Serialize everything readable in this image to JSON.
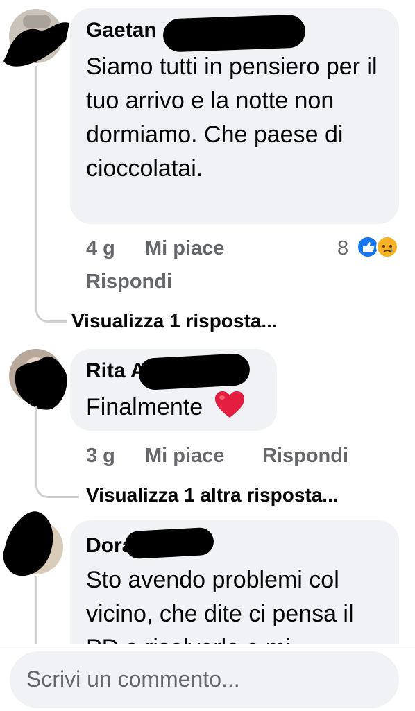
{
  "comments": [
    {
      "author": "Gaetan",
      "text": "Siamo tutti in pensiero per il tuo arrivo e la notte non dormiamo. Che paese di cioccolatai.",
      "time": "4 g",
      "like_label": "Mi piace",
      "reply_label": "Rispondi",
      "reaction_count": "8",
      "reactions": [
        "like-icon",
        "sad-icon"
      ],
      "view_replies": "Visualizza 1 risposta..."
    },
    {
      "author": "Rita A",
      "text": "Finalmente",
      "emoji": "heart-emoji",
      "time": "3 g",
      "like_label": "Mi piace",
      "reply_label": "Rispondi",
      "view_replies": "Visualizza 1 altra risposta..."
    },
    {
      "author": "Dora",
      "text": "Sto avendo problemi col vicino, che dite ci pensa il PD a risolverlo e mi"
    }
  ],
  "composer": {
    "placeholder": "Scrivi un commento..."
  },
  "colors": {
    "bubble": "#f0f2f5",
    "meta": "#65676b",
    "like_blue": "#1877f2",
    "heart_red": "#e41e3f"
  }
}
